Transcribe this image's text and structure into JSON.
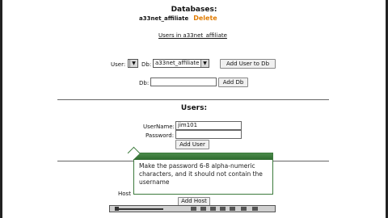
{
  "databases": {
    "title": "Databases:",
    "db_name": "a33net_affiliate",
    "delete_label": "Delete",
    "users_link": "Users in a33net_affiliate"
  },
  "add_user_to_db": {
    "user_label": "User:",
    "db_label": "Db:",
    "db_selected": "a33net_affiliate",
    "button_label": "Add User to Db"
  },
  "add_db": {
    "db_label": "Db:",
    "db_value": "",
    "button_label": "Add Db"
  },
  "users": {
    "title": "Users:",
    "username_label": "UserName:",
    "username_value": "jim101",
    "password_label": "Password:",
    "password_value": "",
    "button_label": "Add User"
  },
  "host": {
    "label": "Host",
    "button_label": "Add Host"
  },
  "tooltip": {
    "text": "Make the password 6-8 alpha-numeric characters, and it should not contain the username"
  },
  "icons": {
    "dropdown": "chevron-down-icon"
  }
}
